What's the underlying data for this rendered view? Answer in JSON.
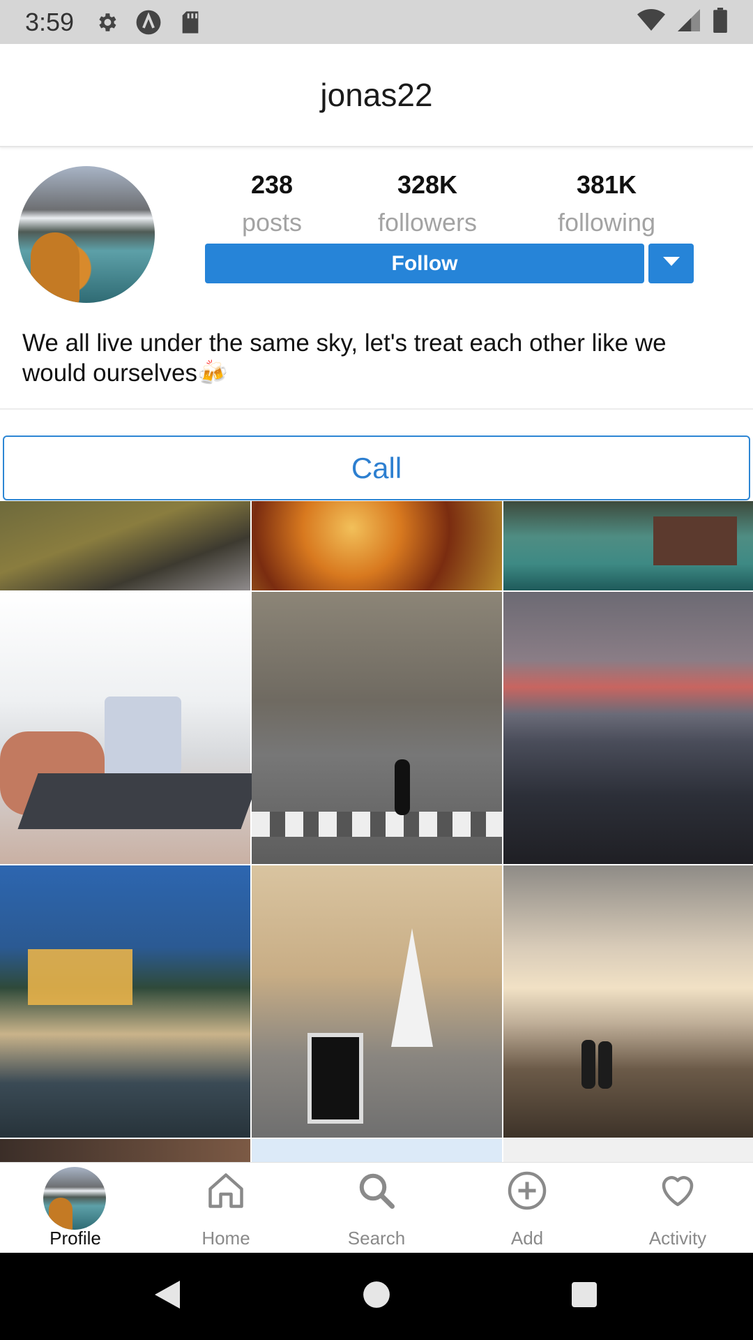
{
  "status_bar": {
    "time": "3:59",
    "left_icons": [
      "gear-icon",
      "autofill-a-icon",
      "sd-card-icon"
    ],
    "right_icons": [
      "wifi-icon",
      "signal-icon",
      "battery-icon"
    ]
  },
  "header": {
    "username": "jonas22"
  },
  "profile": {
    "stats": [
      {
        "value": "238",
        "label": "posts"
      },
      {
        "value": "328K",
        "label": "followers"
      },
      {
        "value": "381K",
        "label": "following"
      }
    ],
    "follow_label": "Follow",
    "bio": "We all live under the same sky, let's treat each other like we would ourselves🍻",
    "call_label": "Call"
  },
  "grid": {
    "tiles": [
      "mountain-slope",
      "autumn-hair",
      "lake-cabin",
      "laptop-coffee-mug",
      "city-crosswalk",
      "ocean-sunset",
      "beach-resort-night",
      "paris-cafe",
      "beach-couple-sunset",
      "partial-tile",
      "partial-tile",
      "partial-tile"
    ]
  },
  "bottom_nav": {
    "items": [
      {
        "label": "Profile",
        "icon": "profile-avatar",
        "active": true
      },
      {
        "label": "Home",
        "icon": "home-icon",
        "active": false
      },
      {
        "label": "Search",
        "icon": "search-icon",
        "active": false
      },
      {
        "label": "Add",
        "icon": "add-circle-icon",
        "active": false
      },
      {
        "label": "Activity",
        "icon": "heart-icon",
        "active": false
      }
    ]
  },
  "colors": {
    "accent": "#2684d8",
    "status_bar": "#d6d6d6",
    "muted_text": "#a3a3a3"
  }
}
